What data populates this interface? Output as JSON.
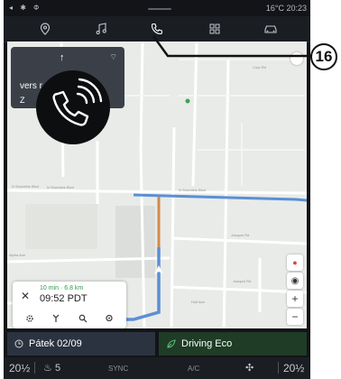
{
  "status_bar": {
    "left_icons": "◂ ✱ Ф",
    "temp_time": "16°C  20:23"
  },
  "top_nav": [
    {
      "icon": "location-pin-icon"
    },
    {
      "icon": "music-icon"
    },
    {
      "icon": "phone-icon",
      "active": true
    },
    {
      "icon": "apps-grid-icon"
    },
    {
      "icon": "car-icon"
    }
  ],
  "nav_banner": {
    "arrow": "↑",
    "direction_text": "vers r",
    "line2": "Z"
  },
  "map": {
    "streets": [
      "N Shoreline Blvd",
      "N Shoreline Blvd",
      "Shoreline Blvd",
      "N Shoreline Blvd",
      "Joaquin Rd",
      "Joaquin Rd",
      "Hulf Ave",
      "Alpha Ave",
      "Corp Rd",
      "Plymouth St",
      "Crittenden Ln",
      "Vineyard"
    ]
  },
  "trip": {
    "eta": "10 min · 6.8 km",
    "arrival": "09:52 PDT"
  },
  "widgets": {
    "date": "Pátek 02/09",
    "driving_mode": "Driving Eco"
  },
  "climate": {
    "left_temp": "20½",
    "seat_level": "5",
    "sync_label": "SYNC",
    "ac_label": "A/C",
    "right_temp": "20½"
  },
  "callout": {
    "number": "16"
  },
  "colors": {
    "route": "#5b8fd6",
    "route_alt": "#d08a4c",
    "accent_green": "#3fa25a"
  }
}
